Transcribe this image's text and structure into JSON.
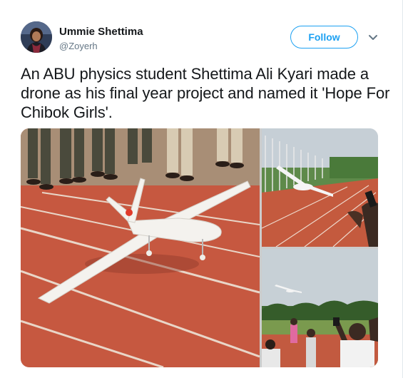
{
  "author": {
    "name": "Ummie Shettima",
    "handle": "@Zoyerh",
    "avatar_icon": "profile-photo"
  },
  "actions": {
    "follow_label": "Follow",
    "menu_icon": "chevron-down-icon"
  },
  "tweet": {
    "text": "An ABU physics student Shettima Ali Kyari made a drone as his final year project and named it 'Hope For Chibok Girls'."
  },
  "media": {
    "photos": [
      {
        "name": "drone-on-track-photo"
      },
      {
        "name": "drone-flying-over-stadium-photo"
      },
      {
        "name": "drone-in-sky-crowd-photo"
      }
    ]
  },
  "colors": {
    "accent": "#1da1f2",
    "text": "#14171a",
    "secondary_text": "#657786",
    "track": "#c85a45"
  }
}
